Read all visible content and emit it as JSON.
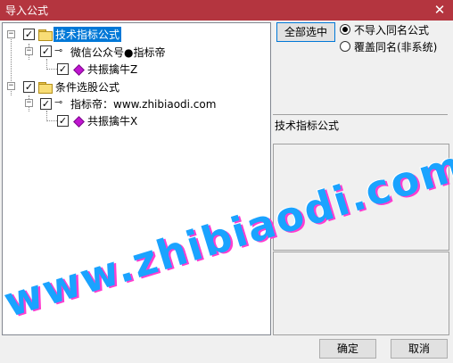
{
  "window": {
    "title": "导入公式",
    "close_glyph": "✕"
  },
  "tree": {
    "nodes": [
      {
        "label": "技术指标公式",
        "checked": "✓",
        "expander": "−",
        "icon": "folder-icon"
      },
      {
        "label": "微信公众号●指标帝",
        "checked": "✓",
        "expander": "−",
        "icon": "key-icon"
      },
      {
        "label": "共振擒牛Z",
        "checked": "✓",
        "icon": "gem-icon"
      },
      {
        "label": "条件选股公式",
        "checked": "✓",
        "expander": "−",
        "icon": "folder-icon"
      },
      {
        "label": "指标帝：www.zhibiaodi.com",
        "checked": "✓",
        "expander": "−",
        "icon": "key-icon"
      },
      {
        "label": "共振擒牛X",
        "checked": "✓",
        "icon": "gem-icon"
      }
    ]
  },
  "options": {
    "select_all_label": "全部选中",
    "radio_skip_label": "不导入同名公式",
    "radio_overwrite_label": "覆盖同名(非系统)"
  },
  "info": {
    "category_label": "技术指标公式"
  },
  "buttons": {
    "ok_label": "确定",
    "cancel_label": "取消"
  },
  "watermark": {
    "text": "www.zhibiaodi.com"
  },
  "colors": {
    "titlebar": "#b4353f",
    "selection": "#0078d7",
    "watermark": "#1aa3ff"
  }
}
